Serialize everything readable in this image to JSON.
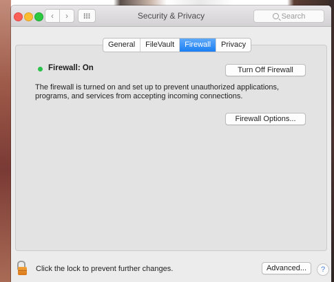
{
  "window": {
    "title": "Security & Privacy"
  },
  "toolbar": {
    "back_icon": "‹",
    "forward_icon": "›",
    "search_placeholder": "Search"
  },
  "tabs": [
    {
      "label": "General",
      "active": false
    },
    {
      "label": "FileVault",
      "active": false
    },
    {
      "label": "Firewall",
      "active": true
    },
    {
      "label": "Privacy",
      "active": false
    }
  ],
  "firewall": {
    "status_label": "Firewall: On",
    "status_color": "#29c24a",
    "turn_off_label": "Turn Off Firewall",
    "description": "The firewall is turned on and set up to prevent unauthorized applications, programs, and services from accepting incoming connections.",
    "options_label": "Firewall Options..."
  },
  "footer": {
    "lock_text": "Click the lock to prevent further changes.",
    "advanced_label": "Advanced...",
    "help_label": "?"
  },
  "colors": {
    "accent": "#1b7ff3",
    "close": "#fc5f57",
    "minimize": "#fdbc2f",
    "zoom": "#2bc840"
  }
}
